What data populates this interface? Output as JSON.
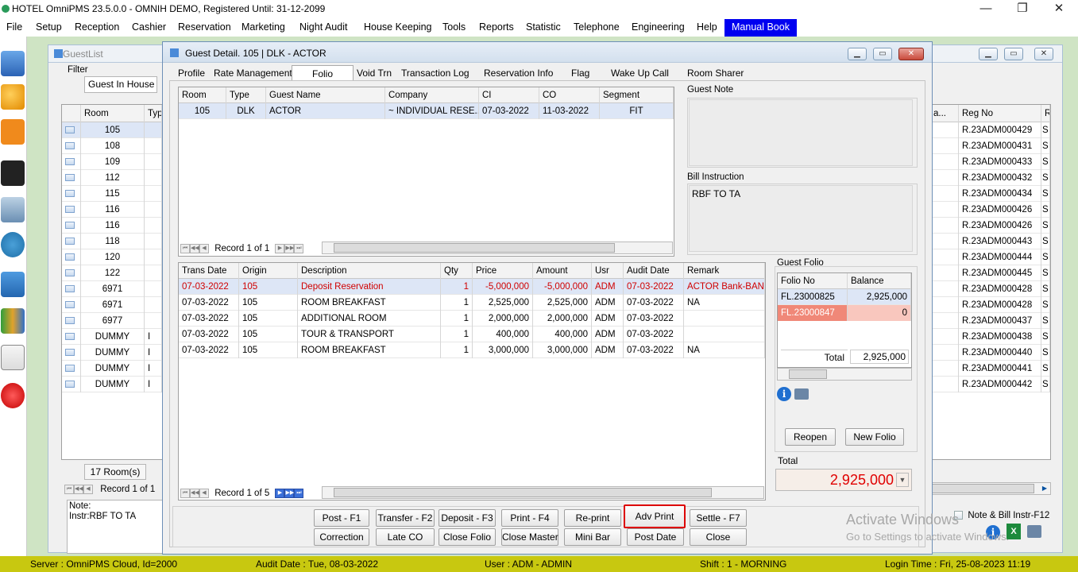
{
  "app": {
    "title": "HOTEL OmniPMS 23.5.0.0 - OMNIH DEMO, Registered Until: 31-12-2099",
    "controls": {
      "minimize": "—",
      "restore": "❐",
      "close": "✕"
    }
  },
  "menu": [
    {
      "label": "File"
    },
    {
      "label": "Setup"
    },
    {
      "label": "Reception"
    },
    {
      "label": "Cashier"
    },
    {
      "label": "Reservation"
    },
    {
      "label": "Marketing"
    },
    {
      "label": "Night Audit"
    },
    {
      "label": "House Keeping"
    },
    {
      "label": "Tools"
    },
    {
      "label": "Reports"
    },
    {
      "label": "Statistic"
    },
    {
      "label": "Telephone"
    },
    {
      "label": "Engineering"
    },
    {
      "label": "Help"
    },
    {
      "label": "Manual Book"
    }
  ],
  "sidebar_icons": [
    "guest-list-icon",
    "users-icon",
    "map-location-icon",
    "calendar-icon",
    "building-icon",
    "rooms-available-icon",
    "shopping-cart-icon",
    "chart-icon",
    "report-pie-icon",
    "power-icon"
  ],
  "guestlist": {
    "title": "GuestList",
    "filter_label": "Filter",
    "filter_value": "Guest In House",
    "columns": {
      "room": "Room",
      "type": "Typ",
      "ra": "a...",
      "regno": "Reg No",
      "r": "R"
    },
    "rows": [
      {
        "room": "105",
        "type": "",
        "regno": "R.23ADM000429",
        "r": "S"
      },
      {
        "room": "108",
        "type": "",
        "regno": "R.23ADM000431",
        "r": "S"
      },
      {
        "room": "109",
        "type": "",
        "regno": "R.23ADM000433",
        "r": "S"
      },
      {
        "room": "112",
        "type": "",
        "regno": "R.23ADM000432",
        "r": "S"
      },
      {
        "room": "115",
        "type": "",
        "regno": "R.23ADM000434",
        "r": "S"
      },
      {
        "room": "116",
        "type": "",
        "regno": "R.23ADM000426",
        "r": "S"
      },
      {
        "room": "116",
        "type": "",
        "regno": "R.23ADM000426",
        "r": "S"
      },
      {
        "room": "118",
        "type": "",
        "regno": "R.23ADM000443",
        "r": "S"
      },
      {
        "room": "120",
        "type": "",
        "regno": "R.23ADM000444",
        "r": "S"
      },
      {
        "room": "122",
        "type": "",
        "regno": "R.23ADM000445",
        "r": "S"
      },
      {
        "room": "6971",
        "type": "",
        "regno": "R.23ADM000428",
        "r": "S"
      },
      {
        "room": "6971",
        "type": "",
        "regno": "R.23ADM000428",
        "r": "S"
      },
      {
        "room": "6977",
        "type": "",
        "regno": "R.23ADM000437",
        "r": "S"
      },
      {
        "room": "DUMMY",
        "type": "I",
        "regno": "R.23ADM000438",
        "r": "S"
      },
      {
        "room": "DUMMY",
        "type": "I",
        "regno": "R.23ADM000440",
        "r": "S"
      },
      {
        "room": "DUMMY",
        "type": "I",
        "regno": "R.23ADM000441",
        "r": "S"
      },
      {
        "room": "DUMMY",
        "type": "I",
        "regno": "R.23ADM000442",
        "r": "S"
      }
    ],
    "footer_count": "17 Room(s)",
    "nav_record": "Record 1 of 1",
    "note_label": "Note:",
    "instr": "Instr:RBF TO TA",
    "chk_label": "Note & Bill Instr-F12"
  },
  "detail": {
    "title": "Guest Detail. 105 | DLK - ACTOR",
    "tabs": [
      "Profile",
      "Rate Management",
      "Folio",
      "Void Trn",
      "Transaction Log",
      "Reservation Info",
      "Flag",
      "Wake Up Call",
      "Room Sharer"
    ],
    "active_tab": "Folio",
    "room_grid": {
      "columns": {
        "room": "Room",
        "type": "Type",
        "guest": "Guest Name",
        "company": "Company",
        "ci": "CI",
        "co": "CO",
        "segment": "Segment"
      },
      "row": {
        "room": "105",
        "type": "DLK",
        "guest": "ACTOR",
        "company": "~ INDIVIDUAL RESE...",
        "ci": "07-03-2022",
        "co": "11-03-2022",
        "segment": "FIT"
      },
      "nav_record": "Record 1 of 1"
    },
    "guest_note_label": "Guest Note",
    "guest_note": "",
    "bill_instruction_label": "Bill Instruction",
    "bill_instruction": "RBF TO TA",
    "trans_grid": {
      "columns": {
        "date": "Trans Date",
        "origin": "Origin",
        "desc": "Description",
        "qty": "Qty",
        "price": "Price",
        "amount": "Amount",
        "usr": "Usr",
        "audit": "Audit Date",
        "remark": "Remark"
      },
      "rows": [
        {
          "date": "07-03-2022",
          "origin": "105",
          "desc": "Deposit Reservation",
          "qty": "1",
          "price": "-5,000,000",
          "amount": "-5,000,000",
          "usr": "ADM",
          "audit": "07-03-2022",
          "remark": "ACTOR Bank-BANK B"
        },
        {
          "date": "07-03-2022",
          "origin": "105",
          "desc": "ROOM BREAKFAST",
          "qty": "1",
          "price": "2,525,000",
          "amount": "2,525,000",
          "usr": "ADM",
          "audit": "07-03-2022",
          "remark": "NA"
        },
        {
          "date": "07-03-2022",
          "origin": "105",
          "desc": "ADDITIONAL ROOM",
          "qty": "1",
          "price": "2,000,000",
          "amount": "2,000,000",
          "usr": "ADM",
          "audit": "07-03-2022",
          "remark": ""
        },
        {
          "date": "07-03-2022",
          "origin": "105",
          "desc": "TOUR & TRANSPORT",
          "qty": "1",
          "price": "400,000",
          "amount": "400,000",
          "usr": "ADM",
          "audit": "07-03-2022",
          "remark": ""
        },
        {
          "date": "07-03-2022",
          "origin": "105",
          "desc": "ROOM BREAKFAST",
          "qty": "1",
          "price": "3,000,000",
          "amount": "3,000,000",
          "usr": "ADM",
          "audit": "07-03-2022",
          "remark": "NA"
        }
      ],
      "nav_record": "Record 1 of 5"
    },
    "guest_folio": {
      "label": "Guest Folio",
      "columns": {
        "folio": "Folio No",
        "balance": "Balance"
      },
      "rows": [
        {
          "folio": "FL.23000825",
          "balance": "2,925,000"
        },
        {
          "folio": "FL.23000847",
          "balance": "0"
        }
      ],
      "total_label": "Total",
      "total_value": "2,925,000",
      "reopen": "Reopen",
      "new_folio": "New Folio"
    },
    "total_label": "Total",
    "total_value": "2,925,000",
    "buttons_row1": [
      "Post - F1",
      "Transfer - F2",
      "Deposit - F3",
      "Print - F4",
      "Re-print",
      "Adv Print",
      "Settle - F7"
    ],
    "buttons_row2": [
      "Correction",
      "Late CO",
      "Close Folio",
      "Close Master",
      "Mini Bar",
      "Post Date",
      "Close"
    ]
  },
  "watermark": {
    "line1": "Activate Windows",
    "line2": "Go to Settings to activate Windows."
  },
  "status": {
    "server": "Server : OmniPMS Cloud, Id=2000",
    "audit": "Audit Date : Tue, 08-03-2022",
    "user": "User : ADM - ADMIN",
    "shift": "Shift : 1 - MORNING",
    "login": "Login Time : Fri, 25-08-2023 11:19"
  },
  "colors": {
    "status_bar": "#c8c810",
    "highlight_menu": "#0000f0",
    "deposit_text": "#d00000",
    "folio_selected": "#f4a8a0",
    "total_red": "#e00000"
  }
}
